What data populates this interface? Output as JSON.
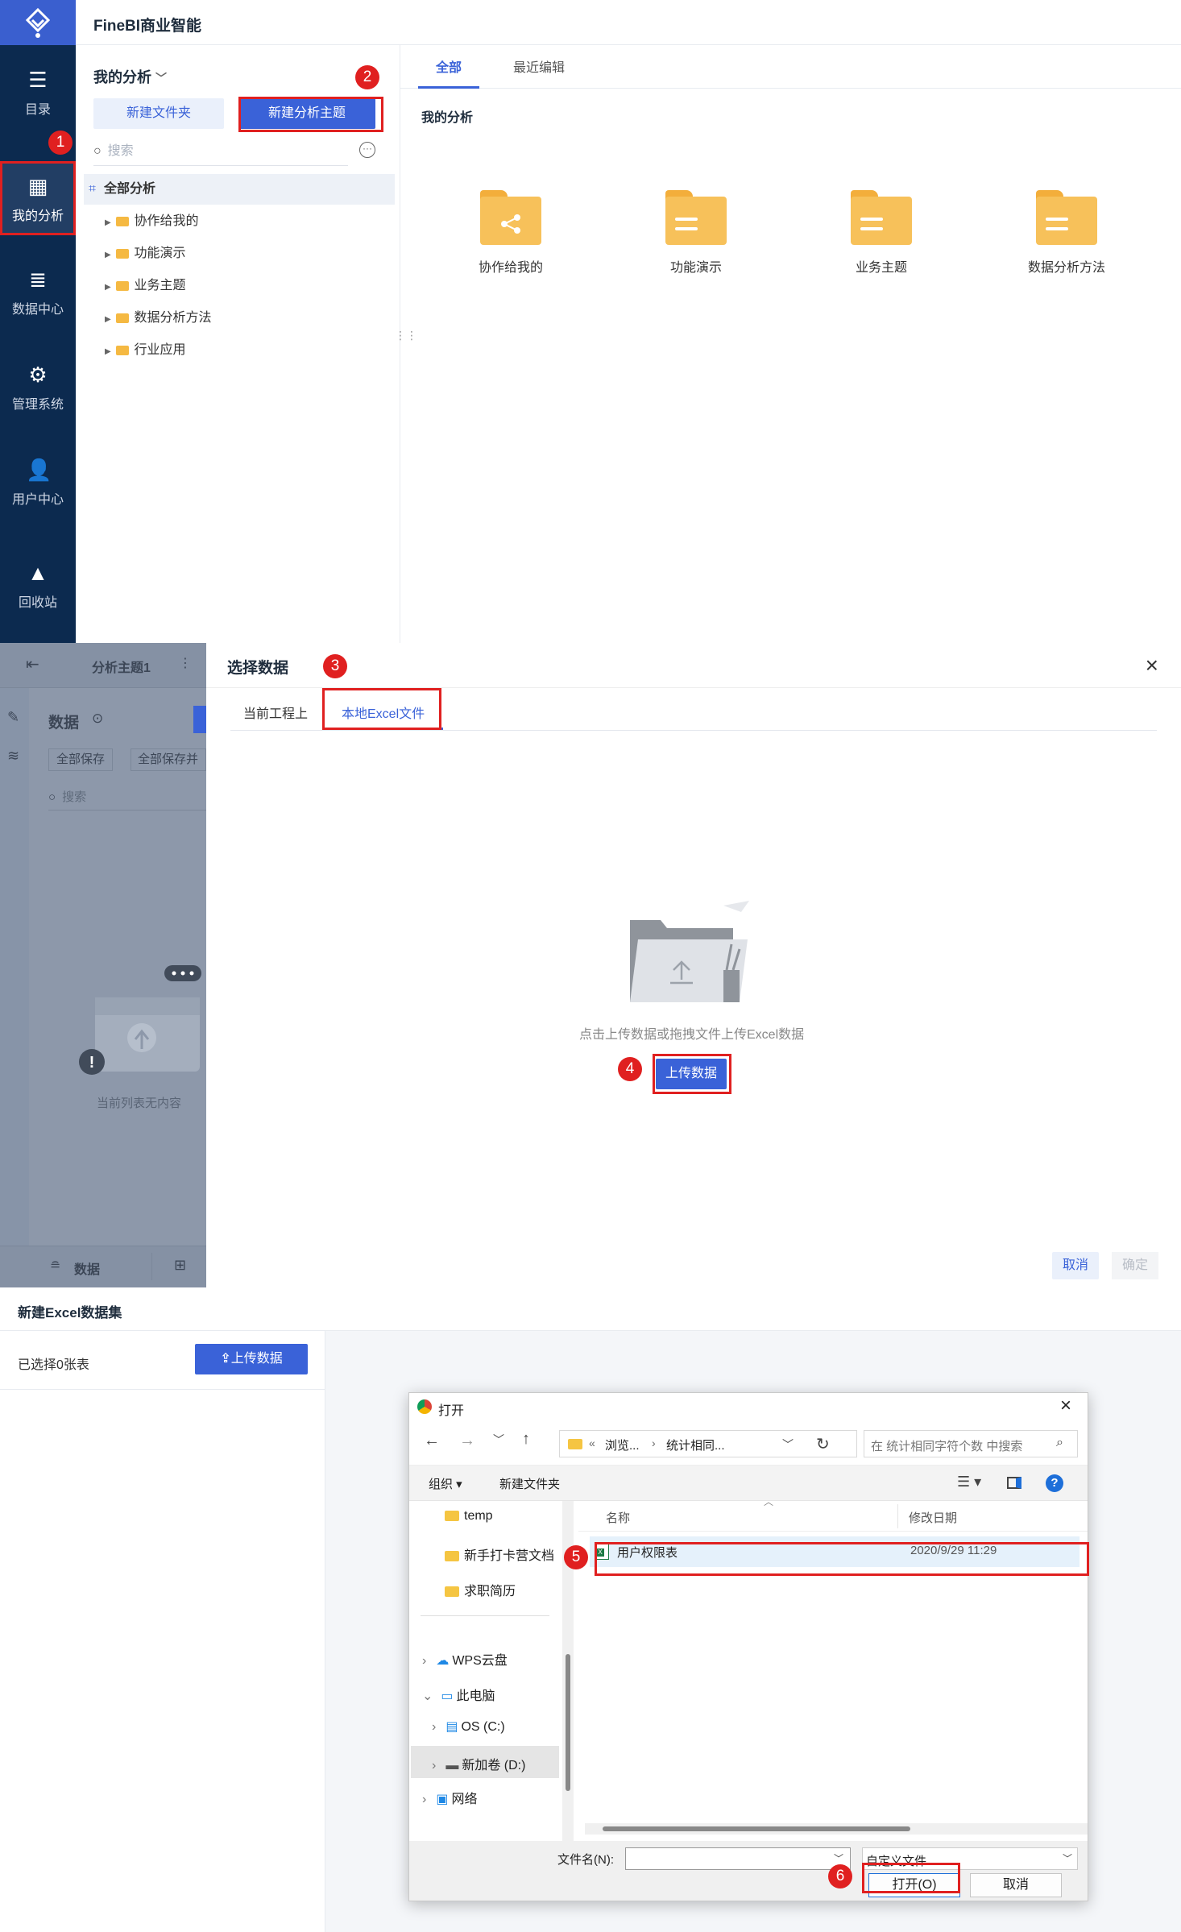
{
  "panel1": {
    "app_title": "FineBI商业智能",
    "nav": [
      {
        "label": "目录",
        "icon": "catalog-icon"
      },
      {
        "label": "我的分析",
        "icon": "analysis-icon"
      },
      {
        "label": "数据中心",
        "icon": "database-icon"
      },
      {
        "label": "管理系统",
        "icon": "gear-icon"
      },
      {
        "label": "用户中心",
        "icon": "user-icon"
      },
      {
        "label": "回收站",
        "icon": "recycle-icon"
      }
    ],
    "tree_header": "我的分析",
    "new_folder_btn": "新建文件夹",
    "new_topic_btn": "新建分析主题",
    "search_placeholder": "搜索",
    "tree_root": "全部分析",
    "tree_items": [
      "协作给我的",
      "功能演示",
      "业务主题",
      "数据分析方法",
      "行业应用"
    ],
    "tabs": [
      "全部",
      "最近编辑"
    ],
    "section_title": "我的分析",
    "folders": [
      "协作给我的",
      "功能演示",
      "业务主题",
      "数据分析方法"
    ]
  },
  "panel2": {
    "left_title": "分析主题1",
    "data_label": "数据",
    "save_all": "全部保存",
    "save_all_2": "全部保存并",
    "search_placeholder": "搜索",
    "empty_text": "当前列表无内容",
    "bottom_data": "数据",
    "dialog_title": "选择数据",
    "tab_current": "当前工程上",
    "tab_excel": "本地Excel文件",
    "hint": "点击上传数据或拖拽文件上传Excel数据",
    "upload_btn": "上传数据",
    "cancel": "取消",
    "confirm": "确定"
  },
  "panel3": {
    "title": "新建Excel数据集",
    "selected": "已选择0张表",
    "upload_btn": "上传数据",
    "window_title": "打开",
    "path_1": "浏览...",
    "path_2": "统计相同...",
    "search_placeholder": "在 统计相同字符个数 中搜索",
    "organize": "组织 ▾",
    "new_folder": "新建文件夹",
    "nav_items": [
      "temp",
      "新手打卡营文档",
      "求职简历",
      "WPS云盘",
      "此电脑",
      "OS (C:)",
      "新加卷 (D:)",
      "网络"
    ],
    "col_name": "名称",
    "col_date": "修改日期",
    "file_name": "用户权限表",
    "file_date": "2020/9/29 11:29",
    "filename_label": "文件名(N):",
    "filter": "自定义文件",
    "open_btn": "打开(O)",
    "cancel_btn": "取消"
  },
  "badges": [
    "1",
    "2",
    "3",
    "4",
    "5",
    "6"
  ],
  "colors": {
    "brand_blue": "#3a62d8",
    "nav_dark": "#0c2a4f",
    "highlight_red": "#e02020",
    "folder_yellow": "#f7c15a"
  }
}
